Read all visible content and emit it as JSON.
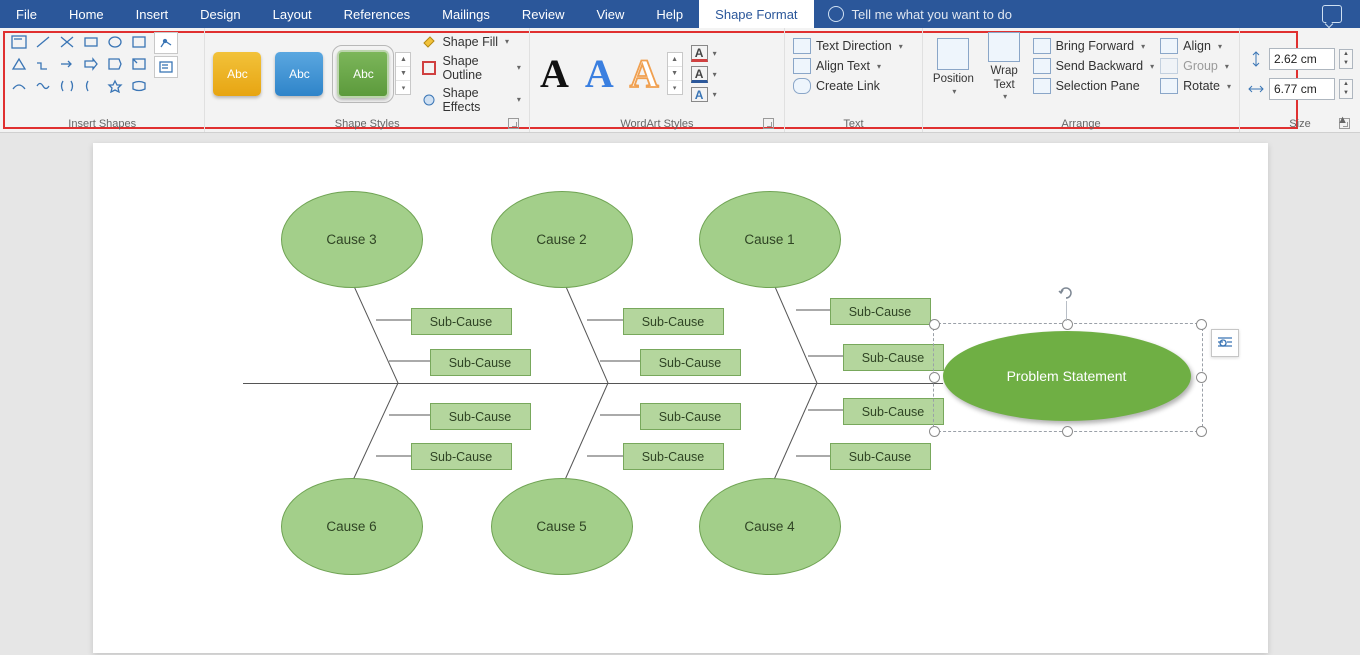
{
  "menu": {
    "tabs": [
      "File",
      "Home",
      "Insert",
      "Design",
      "Layout",
      "References",
      "Mailings",
      "Review",
      "View",
      "Help",
      "Shape Format"
    ],
    "active": "Shape Format",
    "tell_me": "Tell me what you want to do"
  },
  "ribbon": {
    "groups": {
      "insert_shapes": "Insert Shapes",
      "shape_styles": "Shape Styles",
      "wordart_styles": "WordArt Styles",
      "text": "Text",
      "arrange": "Arrange",
      "size": "Size"
    },
    "style_tile_label": "Abc",
    "shape_fill": "Shape Fill",
    "shape_outline": "Shape Outline",
    "shape_effects": "Shape Effects",
    "wordart_letter": "A",
    "text_direction": "Text Direction",
    "align_text": "Align Text",
    "create_link": "Create Link",
    "position": "Position",
    "wrap_text": "Wrap\nText",
    "bring_forward": "Bring Forward",
    "send_backward": "Send Backward",
    "selection_pane": "Selection Pane",
    "align": "Align",
    "group": "Group",
    "rotate": "Rotate",
    "size_h": "2.62 cm",
    "size_w": "6.77 cm"
  },
  "diagram": {
    "problem": "Problem Statement",
    "causes_top": [
      "Cause 3",
      "Cause 2",
      "Cause 1"
    ],
    "causes_bottom": [
      "Cause 6",
      "Cause 5",
      "Cause 4"
    ],
    "sub": "Sub-Cause"
  }
}
